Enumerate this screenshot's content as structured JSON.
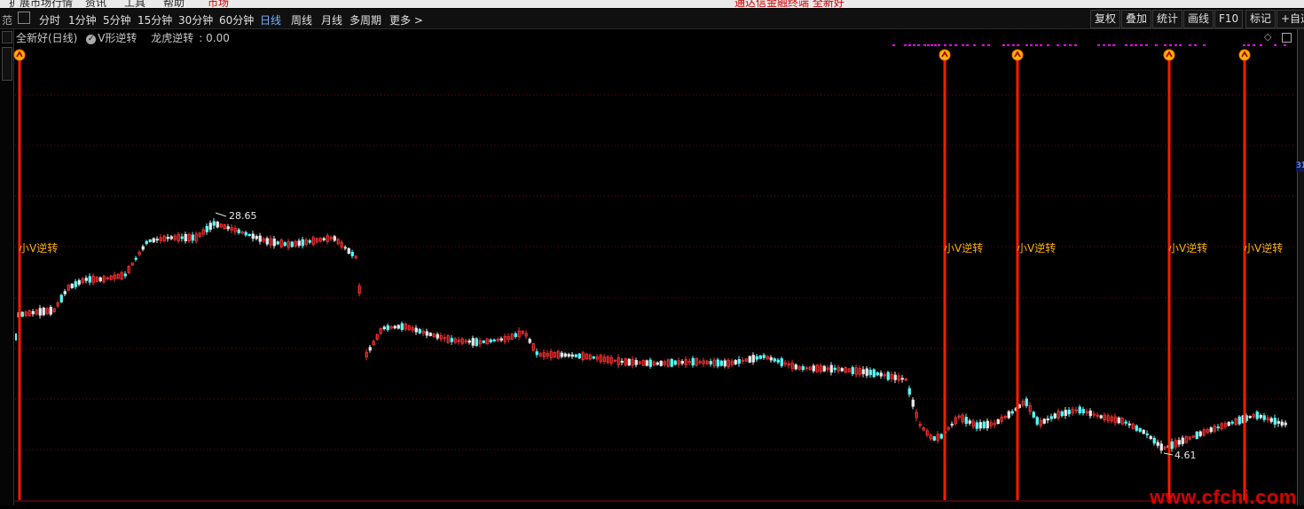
{
  "menu": {
    "items": [
      "扩展市场行情",
      "资讯",
      "工具",
      "帮助"
    ],
    "active_tab": "市场",
    "notice": "通达信金融终端 全新好"
  },
  "periods": [
    "分时",
    "1分钟",
    "5分钟",
    "15分钟",
    "30分钟",
    "60分钟",
    "日线",
    "周线",
    "月线",
    "多周期",
    "更多 >"
  ],
  "active_period": "日线",
  "right_tools": [
    "复权",
    "叠加",
    "统计",
    "画线",
    "F10",
    "标记",
    "+自选"
  ],
  "chart_title": {
    "stock": "全新好(日线)",
    "indicator": "V形逆转",
    "signal_label": "龙虎逆转",
    "signal_value": "0.00"
  },
  "annotations": {
    "high": "28.65",
    "low": "4.61",
    "signal_text": "小V逆转"
  },
  "watermark": "www.cfchi.com",
  "colors": {
    "up": "#ff3030",
    "down": "#54ffff",
    "signal": "#ff1a00",
    "signal_text": "#ffb400",
    "marker": "#ff00ff"
  },
  "chart_data": {
    "type": "candlestick",
    "price_high": 28.65,
    "price_low": 4.61,
    "signal_count": 5
  }
}
